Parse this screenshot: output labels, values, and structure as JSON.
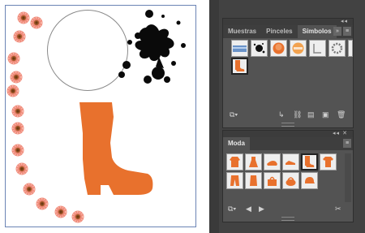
{
  "symbols_panel": {
    "tabs": [
      "Muestras",
      "Pinceles",
      "Símbolos"
    ],
    "menu_glyph": "≡",
    "expand_glyph": "»",
    "collapse_glyph": "◂◂"
  },
  "moda_panel": {
    "title": "Moda",
    "menu_glyph": "≡",
    "close_glyph": "✕",
    "collapse_glyph": "◂◂"
  },
  "colors": {
    "accent_orange": "#E8712D",
    "panel_bg": "#535353",
    "tab_bar": "#3E3E3E"
  }
}
